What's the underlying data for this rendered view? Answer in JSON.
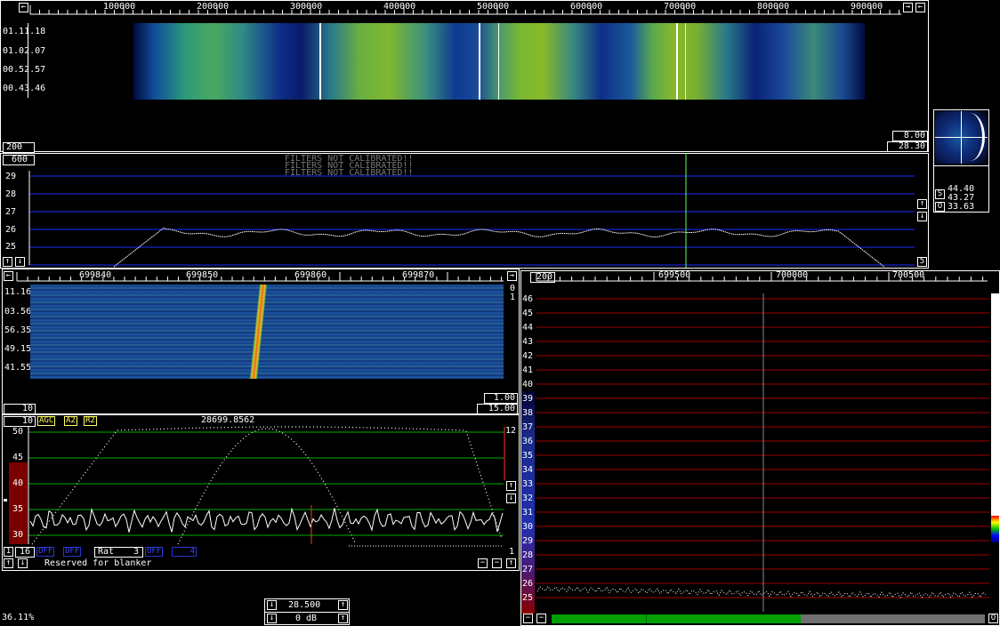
{
  "main_waterfall": {
    "freq_ticks": [
      "100000",
      "200000",
      "300000",
      "400000",
      "500000",
      "600000",
      "700000",
      "800000",
      "900000"
    ],
    "time_labels": [
      "01.11.18",
      "01.02.07",
      "00.52.57",
      "00.43.46"
    ],
    "left_box": "200",
    "right_box_top": "8.00",
    "right_box_bottom": "28.30"
  },
  "main_spectrum": {
    "left_box": "600",
    "warnings": [
      "FILTERS NOT CALIBRATED!!",
      "FILTERS NOT CALIBRATED!!",
      "FILTERS NOT CALIBRATED!!"
    ],
    "y_labels": [
      "29",
      "28",
      "27",
      "26",
      "25"
    ],
    "right_box": "5"
  },
  "side_panel": {
    "s_label": "S",
    "o_label": "O",
    "values": [
      "44.40",
      "43.27",
      "33.63"
    ]
  },
  "baseband_waterfall": {
    "freq_ticks": [
      "699840",
      "699850",
      "699860",
      "699870"
    ],
    "time_labels": [
      "11.16",
      "03.56",
      "56.35",
      "49.15",
      "41.55"
    ],
    "right_top": "0",
    "right_second": "1",
    "box_a": "1.00",
    "box_b": "15.00",
    "left_box": "10"
  },
  "baseband_spectrum": {
    "left_box": "10",
    "tags": [
      "AGC",
      "A2",
      "R2"
    ],
    "frequency": "28699.8562",
    "y_labels": [
      "50",
      "45",
      "40",
      "35",
      "30"
    ],
    "right_top": "12",
    "right_bottom": "1",
    "bottom_left_a": "1",
    "bottom_left_b": "16",
    "blue_tags": [
      "OFF",
      "OFF",
      "OFF",
      "4"
    ],
    "rat_label": "Rat",
    "rat_value": "3",
    "reserved_text": "Reserved for blanker"
  },
  "hires_panel": {
    "left_box": "200",
    "freq_ticks": [
      "699500",
      "700000",
      "700500"
    ],
    "y_labels": [
      "46",
      "45",
      "44",
      "43",
      "42",
      "41",
      "40",
      "39",
      "38",
      "37",
      "36",
      "35",
      "34",
      "33",
      "32",
      "31",
      "30",
      "29",
      "28",
      "27",
      "26",
      "25"
    ],
    "bottom_o": "O"
  },
  "status": {
    "cpu": "36.11%",
    "freq_box": "28.500",
    "db_box": "0 dB"
  },
  "colors": {
    "grid_blue": "#1a2cff",
    "grid_green": "#00b000",
    "grid_red": "#a00000",
    "marker_green": "#60ff60",
    "marker_red": "#ff3030"
  }
}
